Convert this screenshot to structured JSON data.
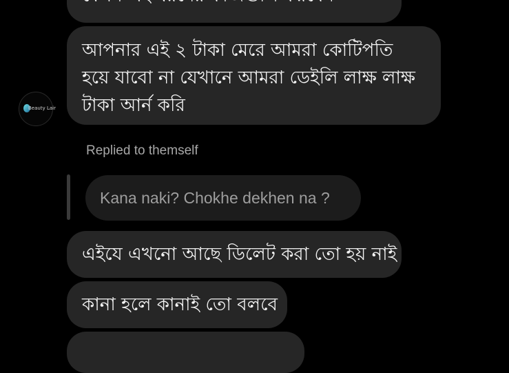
{
  "conversation": {
    "messages": [
      {
        "text": "কেমন এই ধরনের কাজগুলি করবেন"
      },
      {
        "text": "আপনার এই ২ টাকা মেরে আমরা কোটিপতি হয়ে যাবো না যেখানে আমরা ডেইলি লাক্ষ লাক্ষ টাকা আর্ন করি"
      },
      {
        "text": "এইযে এখনো আছে ডিলেট করা তো হয় নাই"
      },
      {
        "text": "কানা হলে কানাই তো বলবে"
      },
      {
        "text": ""
      }
    ],
    "reply": {
      "label": "Replied to themself",
      "quoted_text": "Kana naki?  Chokhe dekhen na ?"
    }
  },
  "avatar": {
    "brand_text": "Beauty Lair",
    "icon": "beauty-lair-logo-icon"
  },
  "colors": {
    "background": "#000000",
    "bubble": "#262626",
    "quoted_bubble": "#1c1c1c",
    "reply_bar": "#3a3a3a",
    "muted_text": "#a8a8a8"
  }
}
